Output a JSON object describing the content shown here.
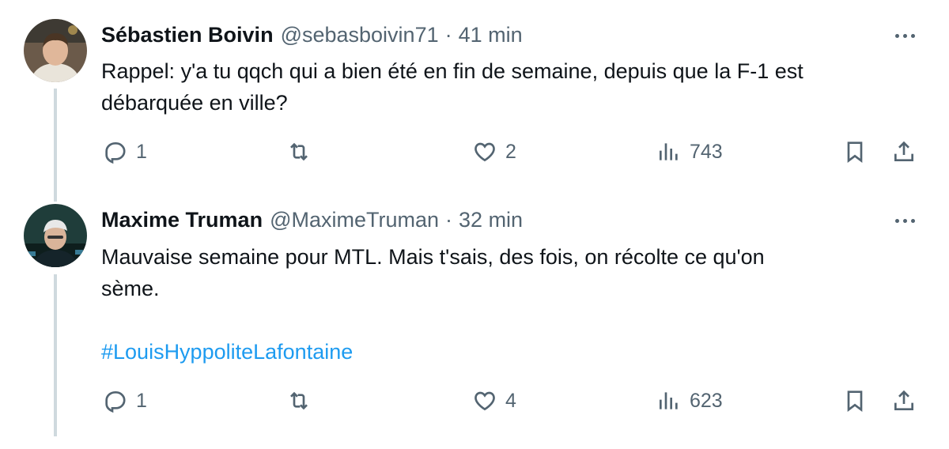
{
  "tweets": [
    {
      "author": {
        "name": "Sébastien Boivin",
        "handle": "@sebasboivin71"
      },
      "separator": "·",
      "time": "41 min",
      "text_line1": "Rappel: y'a tu qqch qui a bien été en fin de semaine, depuis que la F-1 est",
      "text_line2": "débarquée en ville?",
      "stats": {
        "replies": "1",
        "retweets": "",
        "likes": "2",
        "views": "743"
      }
    },
    {
      "author": {
        "name": "Maxime Truman",
        "handle": "@MaximeTruman"
      },
      "separator": "·",
      "time": "32 min",
      "text_line1": "Mauvaise semaine pour MTL. Mais t'sais, des fois, on récolte ce qu'on",
      "text_line2": "sème.",
      "hashtag": "#LouisHyppoliteLafontaine",
      "stats": {
        "replies": "1",
        "retweets": "",
        "likes": "4",
        "views": "623"
      }
    }
  ],
  "icons": [
    "reply-icon",
    "retweet-icon",
    "like-icon",
    "views-icon",
    "bookmark-icon",
    "share-icon",
    "more-icon"
  ],
  "colors": {
    "text": "#0f1419",
    "secondary": "#536471",
    "link": "#1d9bf0",
    "thread_line": "#cfd9de"
  }
}
